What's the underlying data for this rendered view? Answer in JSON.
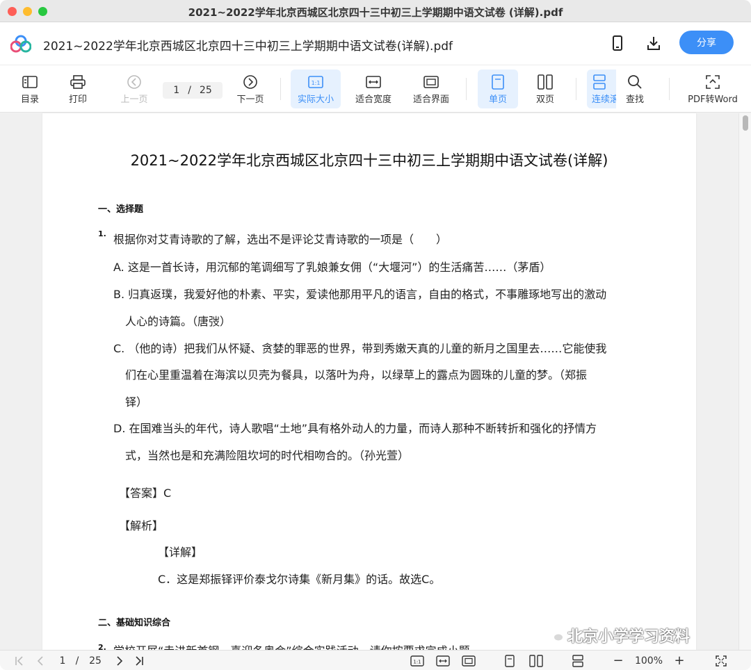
{
  "window": {
    "title": "2021~2022学年北京西城区北京四十三中初三上学期期中语文试卷 (详解).pdf"
  },
  "header": {
    "doc_title": "2021~2022学年北京西城区北京四十三中初三上学期期中语文试卷(详解).pdf",
    "share_label": "分享",
    "icons": [
      "app-logo",
      "phone-icon",
      "download-icon"
    ]
  },
  "toolbar": {
    "toc_label": "目录",
    "print_label": "打印",
    "prev_label": "上一页",
    "current_page": "1",
    "page_sep": "/",
    "total_pages": "25",
    "next_label": "下一页",
    "actual_size_label": "实际大小",
    "fit_width_label": "适合宽度",
    "fit_page_label": "适合界面",
    "single_label": "单页",
    "double_label": "双页",
    "continuous_label": "连续滚",
    "find_label": "查找",
    "pdf_to_word_label": "PDF转Word",
    "accent_color": "#3c8ff7"
  },
  "document": {
    "title": "2021~2022学年北京西城区北京四十三中初三上学期期中语文试卷(详解)",
    "section1": "一、选择题",
    "q1_num": "1.",
    "q1_stem": "根据你对艾青诗歌的了解，选出不是评论艾青诗歌的一项是（　　）",
    "q1_a": "A. 这是一首长诗，用沉郁的笔调细写了乳娘兼女佣（“大堰河”）的生活痛苦……（茅盾）",
    "q1_b1": "B. 归真返璞，我爱好他的朴素、平实，爱读他那用平凡的语言，自由的格式，不事雕琢地写出的激动",
    "q1_b2": "人心的诗篇。（唐弢）",
    "q1_c1": "C. （他的诗）把我们从怀疑、贪婪的罪恶的世界，带到秀嫩天真的儿童的新月之国里去……它能使我",
    "q1_c2": "们在心里重温着在海滨以贝壳为餐具，以落叶为舟，以绿草上的露点为圆珠的儿童的梦。（郑振",
    "q1_c3": "铎）",
    "q1_d1": "D. 在国难当头的年代，诗人歌唱“土地”具有格外动人的力量，而诗人那种不断转折和强化的抒情方",
    "q1_d2": "式，当然也是和充满险阻坎坷的时代相吻合的。（孙光萱）",
    "answer": "【答案】C",
    "analysis": "【解析】",
    "detail": "【详解】",
    "detail_text": "C．这是郑振铎评价泰戈尔诗集《新月集》的话。故选C。",
    "section2": "二、基础知识综合",
    "q2_num": "2.",
    "q2_partial": "学校开展“走进新首钢，喜迎冬奥会”综合实践活动，请你按要求完成小题。"
  },
  "bottom": {
    "current_page": "1",
    "page_sep": "/",
    "total_pages": "25",
    "zoom": "100%",
    "minus": "−",
    "plus": "+"
  },
  "watermark": {
    "text": "北京小学学习资料"
  }
}
